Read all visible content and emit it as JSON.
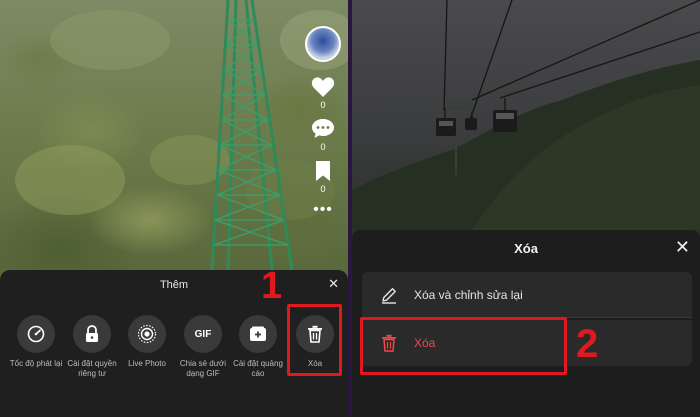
{
  "left_screen": {
    "actions": {
      "like_count": "0",
      "comment_count": "0",
      "save_count": "0",
      "more_label": "•••"
    },
    "sheet": {
      "title": "Thêm",
      "close_label": "✕",
      "options": [
        {
          "label": "Tốc độ phát lại",
          "icon": "speedometer-icon"
        },
        {
          "label": "Cài đặt quyền riêng tư",
          "icon": "lock-icon"
        },
        {
          "label": "Live Photo",
          "icon": "live-photo-icon"
        },
        {
          "label": "Chia sẻ dưới dạng GIF",
          "icon": "gif-icon",
          "icon_text": "GIF"
        },
        {
          "label": "Cài đặt quảng cáo",
          "icon": "ad-settings-icon"
        },
        {
          "label": "Xóa",
          "icon": "trash-icon"
        }
      ]
    },
    "step_number": "1"
  },
  "right_screen": {
    "sheet": {
      "title": "Xóa",
      "close_label": "✕",
      "items": [
        {
          "label": "Xóa và chỉnh sửa lại",
          "icon": "pencil-icon"
        },
        {
          "label": "Xóa",
          "icon": "trash-icon"
        }
      ]
    },
    "step_number": "2"
  },
  "colors": {
    "highlight": "#e0191f",
    "danger_text": "#f04848",
    "sheet_bg": "#1f1f1f"
  }
}
